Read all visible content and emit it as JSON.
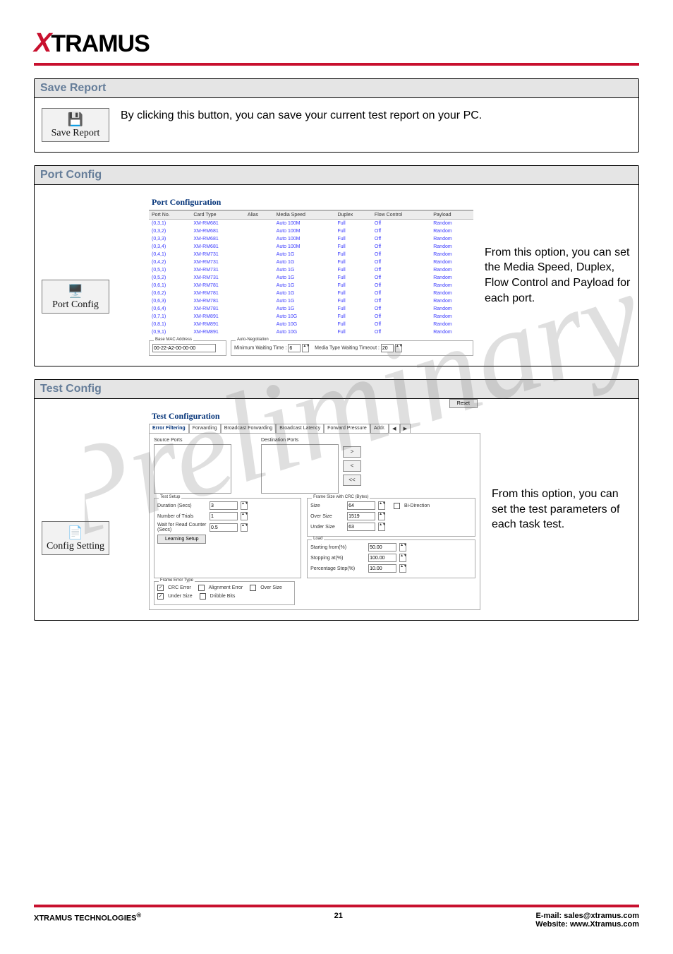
{
  "logo": {
    "x": "X",
    "rest": "TRAMUS"
  },
  "sections": {
    "save": {
      "title": "Save Report",
      "iconLabel": "Save Report",
      "desc": "By clicking this button, you can save your current test report on your PC."
    },
    "port": {
      "title": "Port Config",
      "iconLabel": "Port Config",
      "desc": "From this option, you can set the Media Speed, Duplex, Flow Control and Payload for each port.",
      "panelTitle": "Port Configuration",
      "headers": [
        "Port No.",
        "Card Type",
        "Alias",
        "Media Speed",
        "Duplex",
        "Flow Control",
        "Payload"
      ],
      "rows": [
        [
          "(0,3,1)",
          "XM-RM681",
          "",
          "Auto 100M",
          "Full",
          "Off",
          "Random"
        ],
        [
          "(0,3,2)",
          "XM-RM681",
          "",
          "Auto 100M",
          "Full",
          "Off",
          "Random"
        ],
        [
          "(0,3,3)",
          "XM-RM681",
          "",
          "Auto 100M",
          "Full",
          "Off",
          "Random"
        ],
        [
          "(0,3,4)",
          "XM-RM681",
          "",
          "Auto 100M",
          "Full",
          "Off",
          "Random"
        ],
        [
          "(0,4,1)",
          "XM-RM731",
          "",
          "Auto 1G",
          "Full",
          "Off",
          "Random"
        ],
        [
          "(0,4,2)",
          "XM-RM731",
          "",
          "Auto 1G",
          "Full",
          "Off",
          "Random"
        ],
        [
          "(0,5,1)",
          "XM-RM731",
          "",
          "Auto 1G",
          "Full",
          "Off",
          "Random"
        ],
        [
          "(0,5,2)",
          "XM-RM731",
          "",
          "Auto 1G",
          "Full",
          "Off",
          "Random"
        ],
        [
          "(0,6,1)",
          "XM-RM781",
          "",
          "Auto 1G",
          "Full",
          "Off",
          "Random"
        ],
        [
          "(0,6,2)",
          "XM-RM781",
          "",
          "Auto 1G",
          "Full",
          "Off",
          "Random"
        ],
        [
          "(0,6,3)",
          "XM-RM781",
          "",
          "Auto 1G",
          "Full",
          "Off",
          "Random"
        ],
        [
          "(0,6,4)",
          "XM-RM781",
          "",
          "Auto 1G",
          "Full",
          "Off",
          "Random"
        ],
        [
          "(0,7,1)",
          "XM-RM891",
          "",
          "Auto 10G",
          "Full",
          "Off",
          "Random"
        ],
        [
          "(0,8,1)",
          "XM-RM891",
          "",
          "Auto 10G",
          "Full",
          "Off",
          "Random"
        ],
        [
          "(0,9,1)",
          "XM-RM891",
          "",
          "Auto 10G",
          "Full",
          "Off",
          "Random"
        ]
      ],
      "macLegend": "Base MAC Address",
      "macValue": "00-22-A2-00-00-00",
      "autoNegLegend": "Auto-Negotiation",
      "minWaitLabel": "Minimum Waiting Time :",
      "minWaitValue": "6",
      "mediaTimeoutLabel": "Media Type Waiting Timeout :",
      "mediaTimeoutValue": "20"
    },
    "test": {
      "title": "Test Config",
      "iconLabel": "Config Setting",
      "desc": "From this option, you can set the test parameters of each task test.",
      "panelTitle": "Test Configuration",
      "reset": "Reset",
      "tabs": [
        "Error Filtering",
        "Forwarding",
        "Broadcast Forwarding",
        "Broadcast Latency",
        "Forward Pressure",
        "Addr."
      ],
      "srcLabel": "Source Ports",
      "dstLabel": "Destination Ports",
      "arrowRight": ">",
      "arrowLeft": "<",
      "arrowAllLeft": "<<",
      "setup": {
        "legend": "Test Setup",
        "durationLabel": "Duration (Secs)",
        "durationValue": "3",
        "trialsLabel": "Number of Trials",
        "trialsValue": "1",
        "waitLabel": "Wait for Read Counter (Secs)",
        "waitValue": "0.5",
        "learningBtn": "Learning Setup"
      },
      "frame": {
        "legend": "Frame Size with CRC (Bytes)",
        "sizeLabel": "Size",
        "sizeValue": "64",
        "overLabel": "Over Size",
        "overValue": "1519",
        "underLabel": "Under Size",
        "underValue": "63",
        "bidir": "Bi-Direction"
      },
      "load": {
        "legend": "Load",
        "startLabel": "Starting from(%)",
        "startValue": "50.00",
        "stopLabel": "Stopping at(%)",
        "stopValue": "100.00",
        "stepLabel": "Percentage Step(%)",
        "stepValue": "10.00"
      },
      "error": {
        "legend": "Frame Error Type",
        "crc": "CRC Error",
        "align": "Alignment Error",
        "over": "Over Size",
        "under": "Under Size",
        "dribble": "Dribble Bits"
      }
    }
  },
  "footer": {
    "left": "XTRAMUS TECHNOLOGIES",
    "reg": "®",
    "page": "21",
    "email": "E-mail: sales@xtramus.com",
    "site": "Website:  www.Xtramus.com"
  }
}
